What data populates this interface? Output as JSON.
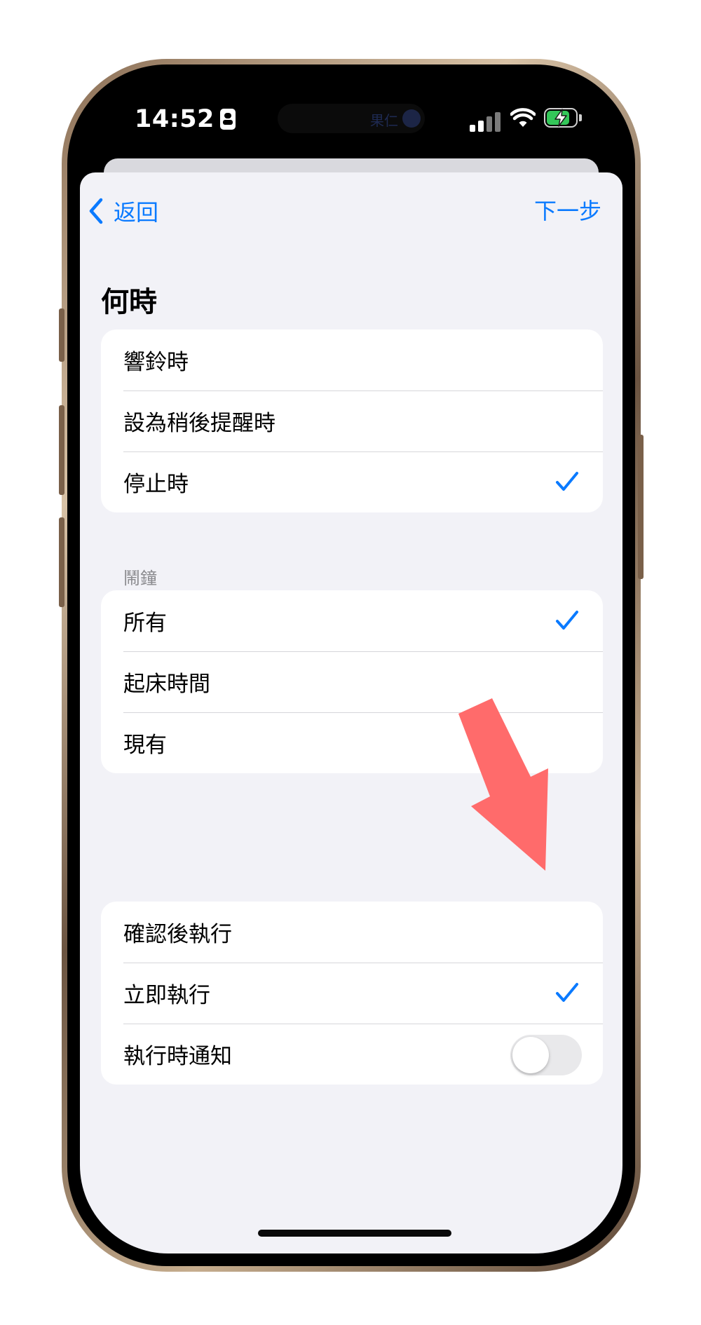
{
  "status_bar": {
    "time": "14:52",
    "island_label": "果仁"
  },
  "nav": {
    "back_label": "返回",
    "next_label": "下一步"
  },
  "title": "何時",
  "trigger_group": {
    "items": [
      {
        "label": "響鈴時",
        "checked": false
      },
      {
        "label": "設為稍後提醒時",
        "checked": false
      },
      {
        "label": "停止時",
        "checked": true
      }
    ]
  },
  "alarm_group": {
    "header": "鬧鐘",
    "items": [
      {
        "label": "所有",
        "checked": true
      },
      {
        "label": "起床時間",
        "checked": false
      },
      {
        "label": "現有",
        "checked": false
      }
    ]
  },
  "run_group": {
    "items": [
      {
        "label": "確認後執行",
        "checked": false
      },
      {
        "label": "立即執行",
        "checked": true
      }
    ],
    "notify": {
      "label": "執行時通知",
      "enabled": false
    }
  },
  "colors": {
    "accent": "#0a7aff",
    "background": "#f2f2f7",
    "arrow": "#ff6b6b"
  }
}
